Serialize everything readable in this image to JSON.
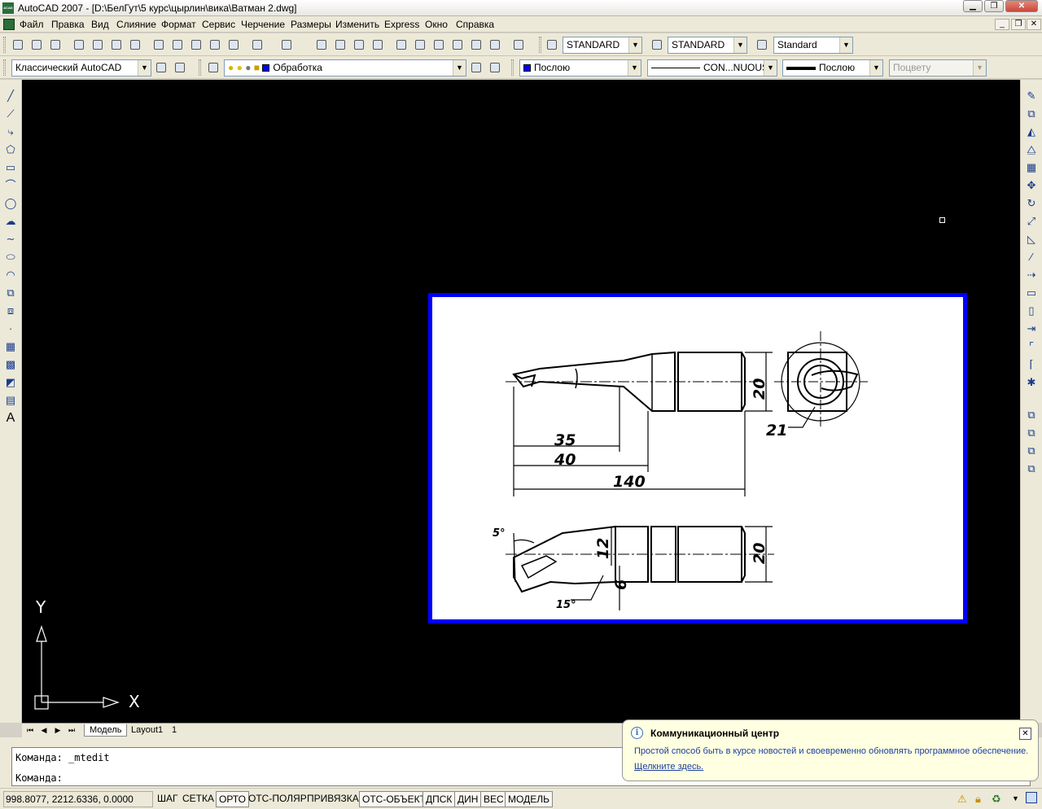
{
  "window": {
    "title": "AutoCAD 2007 - [D:\\БелГут\\5 курс\\цырлин\\вика\\Ватман 2.dwg]",
    "app_icon_text": "ACAD"
  },
  "menu": [
    "Файл",
    "Правка",
    "Вид",
    "Слияние",
    "Формат",
    "Сервис",
    "Черчение",
    "Размеры",
    "Изменить",
    "Express",
    "Окно",
    "Справка"
  ],
  "toolbar1": {
    "text_style": "STANDARD",
    "dim_style": "STANDARD",
    "table_style": "Standard"
  },
  "toolbar2": {
    "workspace": "Классический AutoCAD",
    "layer": "Обработка",
    "color": "Послою",
    "color_hex": "#0000ff",
    "linetype": "CON...NUOUS",
    "lineweight": "Послою",
    "plotstyle": "Поцвету"
  },
  "ucs": {
    "x_label": "X",
    "y_label": "Y"
  },
  "drawing_dims": {
    "top": [
      "35",
      "40",
      "140",
      "20",
      "21"
    ],
    "bottom": [
      "5°",
      "12",
      "20",
      "6",
      "15°"
    ]
  },
  "tabs": {
    "model": "Модель",
    "layout1": "Layout1",
    "other": "1"
  },
  "command": {
    "line1": "Команда:  _mtedit",
    "line2": "Команда:"
  },
  "status": {
    "coords": "998.8077, 2212.6336, 0.0000",
    "buttons": [
      "ШАГ",
      "СЕТКА",
      "ОРТО",
      "ОТС-ПОЛЯР",
      "ПРИВЯЗКА",
      "ОТС-ОБЪЕКТ",
      "ДПСК",
      "ДИН",
      "ВЕС",
      "МОДЕЛЬ"
    ]
  },
  "balloon": {
    "title": "Коммуникационный центр",
    "text": "Простой способ быть в курсе новостей и своевременно обновлять программное обеспечение.",
    "link": "Щелкните здесь."
  },
  "colors": {
    "canvas": "#000000",
    "frame": "#0000ff",
    "ui": "#ece9d8"
  }
}
